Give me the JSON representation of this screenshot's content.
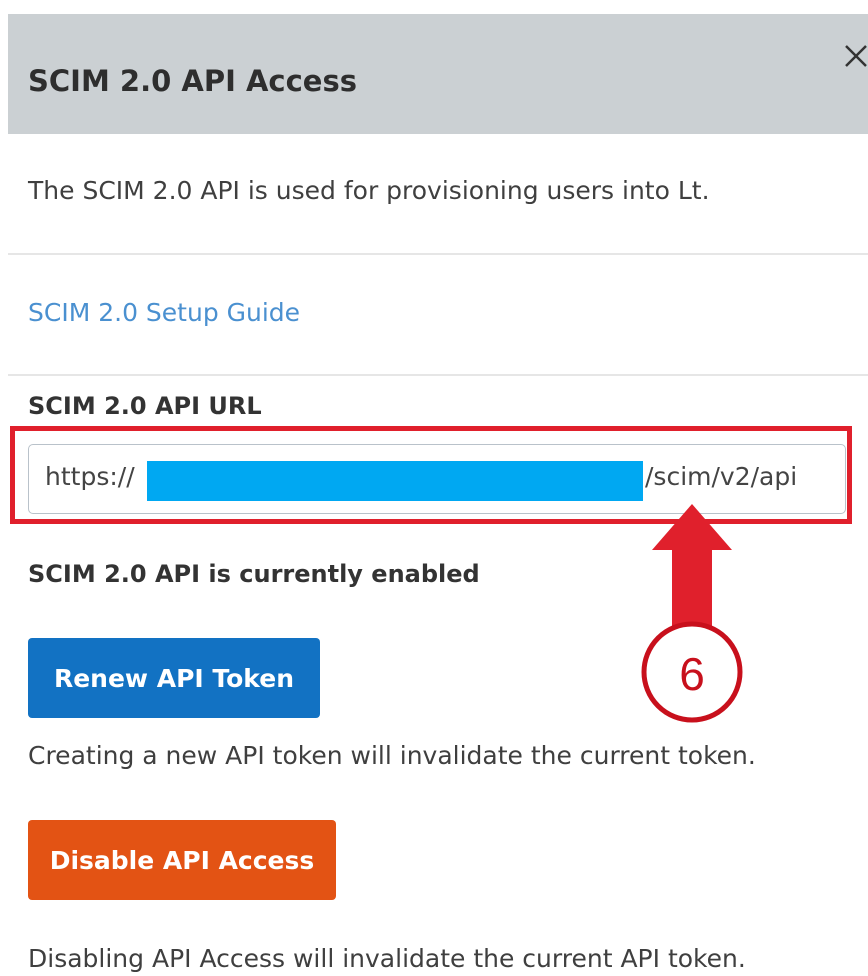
{
  "dialog": {
    "title": "SCIM 2.0 API Access",
    "close_icon": "close-icon",
    "description": "The SCIM 2.0 API is used for provisioning users into Lt.",
    "setup_guide_link": "SCIM 2.0 Setup Guide",
    "api_url": {
      "label": "SCIM 2.0 API URL",
      "prefix": "https://",
      "suffix": "/scim/v2/api"
    },
    "status": "SCIM 2.0 API is currently enabled",
    "renew": {
      "button_label": "Renew API Token",
      "note": "Creating a new API token will invalidate the current token."
    },
    "disable": {
      "button_label": "Disable API Access",
      "note": "Disabling API Access will invalidate the current API token."
    }
  },
  "annotation": {
    "step_number": "6"
  },
  "colors": {
    "header_bg": "#cbd0d3",
    "link": "#4a90d0",
    "renew_button": "#1272c3",
    "disable_button": "#e35314",
    "highlight_red": "#e0202c",
    "redaction": "#00a8f2"
  }
}
